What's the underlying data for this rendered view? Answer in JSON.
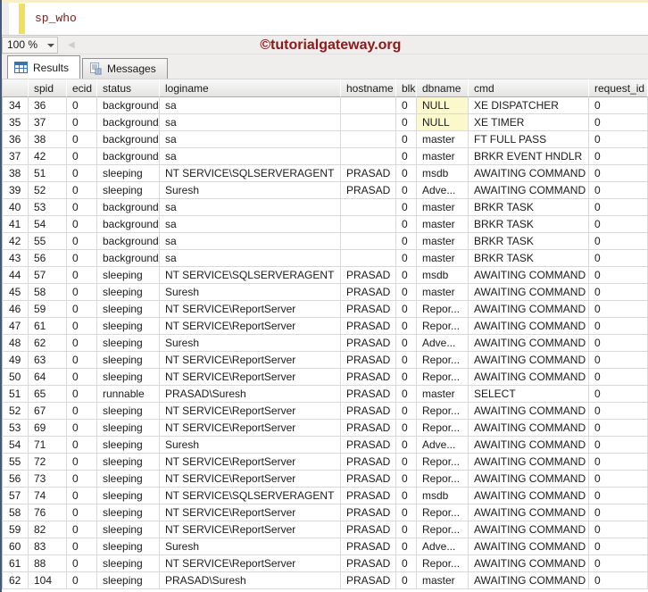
{
  "editor": {
    "query_text": "sp_who"
  },
  "toolbar": {
    "zoom_value": "100 %"
  },
  "watermark": {
    "text": "©tutorialgateway.org"
  },
  "tabs": {
    "results": {
      "label": "Results"
    },
    "messages": {
      "label": "Messages"
    }
  },
  "grid": {
    "columns": [
      "",
      "spid",
      "ecid",
      "status",
      "loginame",
      "hostname",
      "blk",
      "dbname",
      "cmd",
      "request_id"
    ],
    "rows": [
      [
        "34",
        "36",
        "0",
        "background",
        "sa",
        "",
        "0",
        "NULL",
        "XE DISPATCHER",
        "0"
      ],
      [
        "35",
        "37",
        "0",
        "background",
        "sa",
        "",
        "0",
        "NULL",
        "XE TIMER",
        "0"
      ],
      [
        "36",
        "38",
        "0",
        "background",
        "sa",
        "",
        "0",
        "master",
        "FT FULL PASS",
        "0"
      ],
      [
        "37",
        "42",
        "0",
        "background",
        "sa",
        "",
        "0",
        "master",
        "BRKR EVENT HNDLR",
        "0"
      ],
      [
        "38",
        "51",
        "0",
        "sleeping",
        "NT SERVICE\\SQLSERVERAGENT",
        "PRASAD",
        "0",
        "msdb",
        "AWAITING COMMAND",
        "0"
      ],
      [
        "39",
        "52",
        "0",
        "sleeping",
        "Suresh",
        "PRASAD",
        "0",
        "Adve...",
        "AWAITING COMMAND",
        "0"
      ],
      [
        "40",
        "53",
        "0",
        "background",
        "sa",
        "",
        "0",
        "master",
        "BRKR TASK",
        "0"
      ],
      [
        "41",
        "54",
        "0",
        "background",
        "sa",
        "",
        "0",
        "master",
        "BRKR TASK",
        "0"
      ],
      [
        "42",
        "55",
        "0",
        "background",
        "sa",
        "",
        "0",
        "master",
        "BRKR TASK",
        "0"
      ],
      [
        "43",
        "56",
        "0",
        "background",
        "sa",
        "",
        "0",
        "master",
        "BRKR TASK",
        "0"
      ],
      [
        "44",
        "57",
        "0",
        "sleeping",
        "NT SERVICE\\SQLSERVERAGENT",
        "PRASAD",
        "0",
        "msdb",
        "AWAITING COMMAND",
        "0"
      ],
      [
        "45",
        "58",
        "0",
        "sleeping",
        "Suresh",
        "PRASAD",
        "0",
        "master",
        "AWAITING COMMAND",
        "0"
      ],
      [
        "46",
        "59",
        "0",
        "sleeping",
        "NT SERVICE\\ReportServer",
        "PRASAD",
        "0",
        "Repor...",
        "AWAITING COMMAND",
        "0"
      ],
      [
        "47",
        "61",
        "0",
        "sleeping",
        "NT SERVICE\\ReportServer",
        "PRASAD",
        "0",
        "Repor...",
        "AWAITING COMMAND",
        "0"
      ],
      [
        "48",
        "62",
        "0",
        "sleeping",
        "Suresh",
        "PRASAD",
        "0",
        "Adve...",
        "AWAITING COMMAND",
        "0"
      ],
      [
        "49",
        "63",
        "0",
        "sleeping",
        "NT SERVICE\\ReportServer",
        "PRASAD",
        "0",
        "Repor...",
        "AWAITING COMMAND",
        "0"
      ],
      [
        "50",
        "64",
        "0",
        "sleeping",
        "NT SERVICE\\ReportServer",
        "PRASAD",
        "0",
        "Repor...",
        "AWAITING COMMAND",
        "0"
      ],
      [
        "51",
        "65",
        "0",
        "runnable",
        "PRASAD\\Suresh",
        "PRASAD",
        "0",
        "master",
        "SELECT",
        "0"
      ],
      [
        "52",
        "67",
        "0",
        "sleeping",
        "NT SERVICE\\ReportServer",
        "PRASAD",
        "0",
        "Repor...",
        "AWAITING COMMAND",
        "0"
      ],
      [
        "53",
        "69",
        "0",
        "sleeping",
        "NT SERVICE\\ReportServer",
        "PRASAD",
        "0",
        "Repor...",
        "AWAITING COMMAND",
        "0"
      ],
      [
        "54",
        "71",
        "0",
        "sleeping",
        "Suresh",
        "PRASAD",
        "0",
        "Adve...",
        "AWAITING COMMAND",
        "0"
      ],
      [
        "55",
        "72",
        "0",
        "sleeping",
        "NT SERVICE\\ReportServer",
        "PRASAD",
        "0",
        "Repor...",
        "AWAITING COMMAND",
        "0"
      ],
      [
        "56",
        "73",
        "0",
        "sleeping",
        "NT SERVICE\\ReportServer",
        "PRASAD",
        "0",
        "Repor...",
        "AWAITING COMMAND",
        "0"
      ],
      [
        "57",
        "74",
        "0",
        "sleeping",
        "NT SERVICE\\SQLSERVERAGENT",
        "PRASAD",
        "0",
        "msdb",
        "AWAITING COMMAND",
        "0"
      ],
      [
        "58",
        "76",
        "0",
        "sleeping",
        "NT SERVICE\\ReportServer",
        "PRASAD",
        "0",
        "Repor...",
        "AWAITING COMMAND",
        "0"
      ],
      [
        "59",
        "82",
        "0",
        "sleeping",
        "NT SERVICE\\ReportServer",
        "PRASAD",
        "0",
        "Repor...",
        "AWAITING COMMAND",
        "0"
      ],
      [
        "60",
        "83",
        "0",
        "sleeping",
        "Suresh",
        "PRASAD",
        "0",
        "Adve...",
        "AWAITING COMMAND",
        "0"
      ],
      [
        "61",
        "88",
        "0",
        "sleeping",
        "NT SERVICE\\ReportServer",
        "PRASAD",
        "0",
        "Repor...",
        "AWAITING COMMAND",
        "0"
      ],
      [
        "62",
        "104",
        "0",
        "sleeping",
        "PRASAD\\Suresh",
        "PRASAD",
        "0",
        "master",
        "AWAITING COMMAND",
        "0"
      ]
    ]
  },
  "icons": {
    "results_tab": "results-grid-icon",
    "messages_tab": "messages-icon",
    "zoom": "chevron-down-icon",
    "hscroll": "chevron-left-icon"
  },
  "colors": {
    "null_cell_bg": "#fbf8cc",
    "watermark_text": "#8b1a1a",
    "query_text": "#77201d",
    "change_bar": "#f2de5f",
    "results_icon_blue": "#3f6fb4"
  }
}
